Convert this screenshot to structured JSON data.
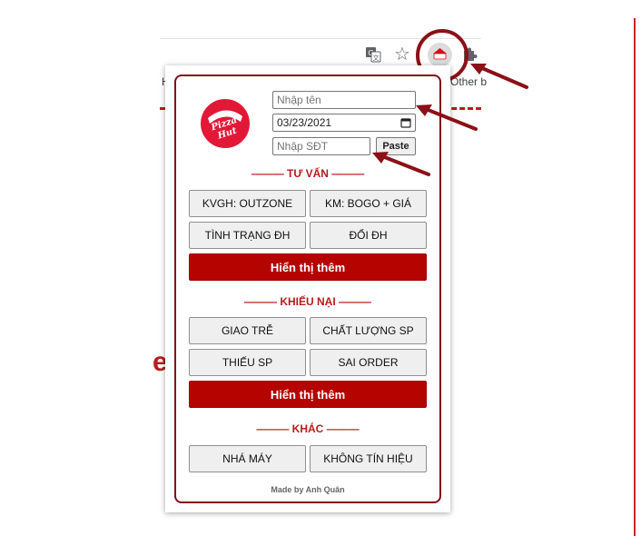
{
  "browser": {
    "bookmark_partial": "H",
    "bookmark_other": "Other b",
    "background_partial_text": "e"
  },
  "popup": {
    "form": {
      "name_placeholder": "Nhập tên",
      "date_value": "03/23/2021",
      "phone_placeholder": "Nhập SĐT",
      "paste_label": "Paste"
    },
    "sections": {
      "tu_van": {
        "title": "——— TƯ VẤN ———",
        "buttons": [
          "KVGH: OUTZONE",
          "KM: BOGO + GIÁ",
          "TÌNH TRẠNG ĐH",
          "ĐỔI ĐH"
        ],
        "more_label": "Hiển thị thêm"
      },
      "khieu_nai": {
        "title": "——— KHIẾU NẠI ———",
        "buttons": [
          "GIAO TRỄ",
          "CHẤT LƯỢNG SP",
          "THIẾU SP",
          "SAI ORDER"
        ],
        "more_label": "Hiển thị thêm"
      },
      "khac": {
        "title": "——— KHÁC ———",
        "buttons": [
          "NHÁ MÁY",
          "KHÔNG TÍN HIỆU"
        ]
      }
    },
    "footer": "Made by Anh Quân"
  },
  "colors": {
    "brand_red": "#b50300",
    "heading_red": "#b71c1c",
    "annotation_red": "#8b1018"
  },
  "icons": [
    "translate-icon",
    "star-icon",
    "pizza-hut-extension-icon",
    "puzzle-icon",
    "calendar-icon"
  ]
}
